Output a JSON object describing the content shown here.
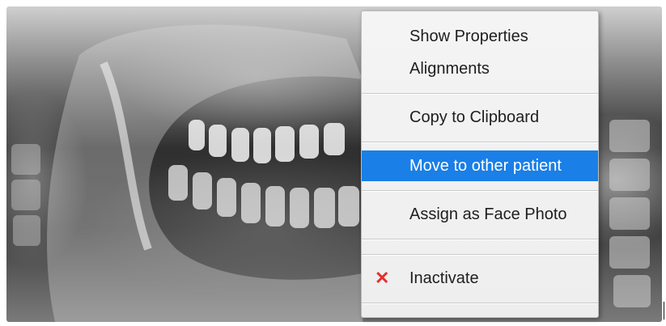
{
  "context_menu": {
    "items": [
      {
        "label": "Show Properties"
      },
      {
        "label": "Alignments"
      },
      {
        "label": "Copy to Clipboard"
      },
      {
        "label": "Move to other patient"
      },
      {
        "label": "Assign as Face Photo"
      },
      {
        "label": "Inactivate",
        "icon": "x-mark-icon"
      }
    ],
    "highlight_color": "#1a7fe6",
    "inactivate_icon_glyph": "✕",
    "inactivate_icon_color": "#e03030"
  },
  "image": {
    "type": "panoramic dental x-ray",
    "icon": "dental-xray-image"
  }
}
